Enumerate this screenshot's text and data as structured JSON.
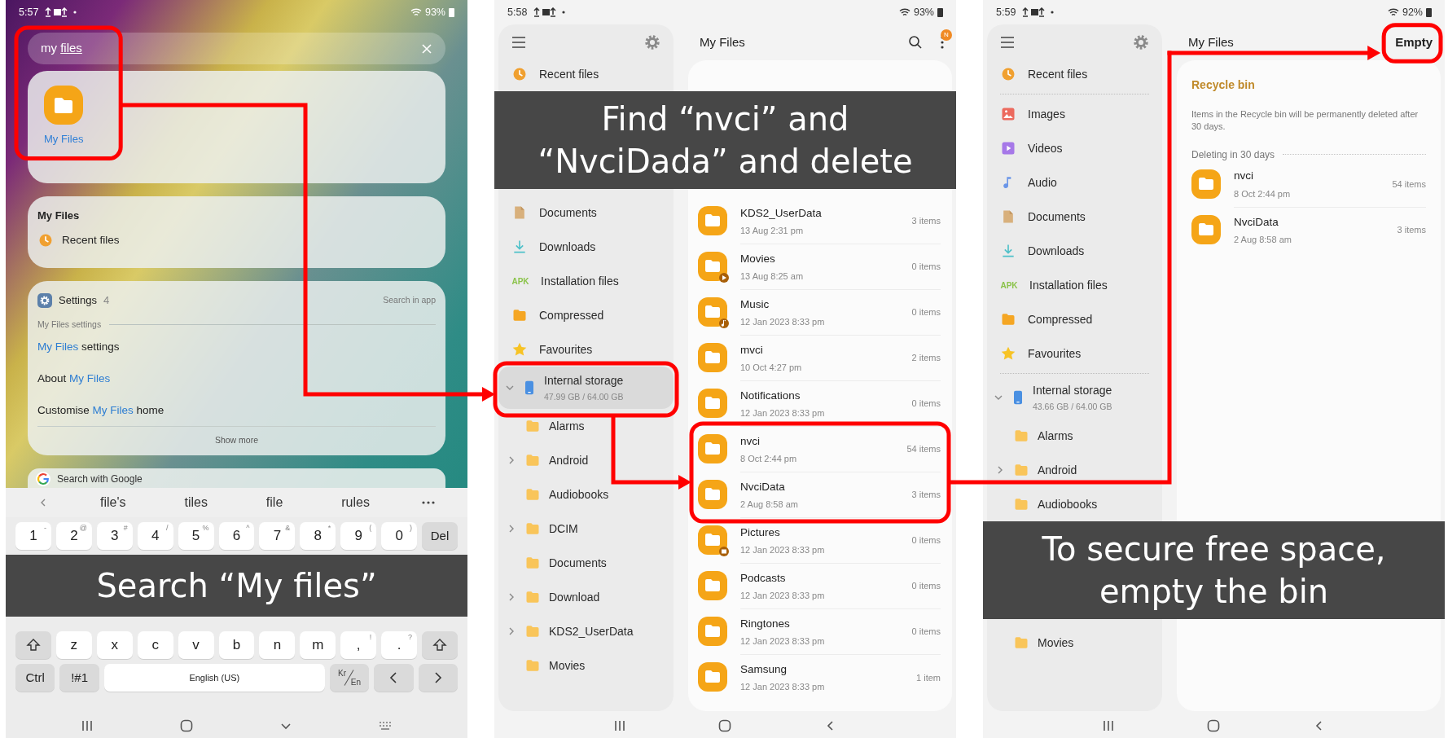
{
  "panels": [
    {
      "kind": "search",
      "status_bar": {
        "time": "5:57",
        "battery": "93%"
      },
      "search": {
        "typed": "my",
        "composing": "files"
      },
      "app_result": {
        "label": "My Files"
      },
      "app_card": {
        "title": "My Files",
        "items": [
          "Recent files"
        ]
      },
      "settings_card": {
        "title": "Settings",
        "count": "4",
        "action": "Search in app",
        "section": "My Files settings",
        "items": [
          "**My Files** settings",
          "About **My Files**",
          "Customise **My Files** home"
        ],
        "more": "Show more"
      },
      "web_search": {
        "label": "Search with Google"
      },
      "keyboard": {
        "suggestions": [
          "file's",
          "tiles",
          "file",
          "rules"
        ],
        "rows_above": [
          [
            {
              "kind": "char",
              "label": "1",
              "alt": "-"
            },
            {
              "kind": "char",
              "label": "2",
              "alt": "@"
            },
            {
              "kind": "char",
              "label": "3",
              "alt": "#"
            },
            {
              "kind": "char",
              "label": "4",
              "alt": "/"
            },
            {
              "kind": "char",
              "label": "5",
              "alt": "%"
            },
            {
              "kind": "char",
              "label": "6",
              "alt": "^"
            },
            {
              "kind": "char",
              "label": "7",
              "alt": "&"
            },
            {
              "kind": "char",
              "label": "8",
              "alt": "*"
            },
            {
              "kind": "char",
              "label": "9",
              "alt": "("
            },
            {
              "kind": "char",
              "label": "0",
              "alt": ")"
            },
            {
              "kind": "text",
              "label": "Del"
            }
          ]
        ],
        "caption": "Search “My files”",
        "rows_below": [
          [
            {
              "kind": "shift"
            },
            {
              "kind": "char",
              "label": "z"
            },
            {
              "kind": "char",
              "label": "x"
            },
            {
              "kind": "char",
              "label": "c"
            },
            {
              "kind": "char",
              "label": "v"
            },
            {
              "kind": "char",
              "label": "b"
            },
            {
              "kind": "char",
              "label": "n"
            },
            {
              "kind": "char",
              "label": "m"
            },
            {
              "kind": "char",
              "label": ",",
              "alt": "!"
            },
            {
              "kind": "char",
              "label": ".",
              "alt": "?"
            },
            {
              "kind": "shift"
            }
          ],
          [
            {
              "kind": "text",
              "label": "Ctrl"
            },
            {
              "kind": "text",
              "label": "!#1"
            },
            {
              "kind": "space",
              "label": "English (US)"
            },
            {
              "kind": "lang",
              "label": "Kr",
              "alt": "En"
            },
            {
              "kind": "left"
            },
            {
              "kind": "right"
            }
          ]
        ]
      },
      "nav_bar": [
        {
          "kind": "recents"
        },
        {
          "kind": "home"
        },
        {
          "kind": "hide"
        },
        {
          "kind": "keyboard"
        }
      ]
    },
    {
      "kind": "files",
      "status_bar": {
        "time": "5:58",
        "battery": "93%"
      },
      "sections": [
        {
          "kind": "split",
          "sidebar": [
            {
              "kind": "toolbar"
            },
            {
              "kind": "recent",
              "label": "Recent files",
              "selected": false
            }
          ],
          "main": [
            {
              "kind": "header",
              "title": "My Files",
              "actions": [
                {
                  "kind": "search"
                },
                {
                  "kind": "more",
                  "badge": "N"
                }
              ]
            },
            {
              "kind": "card"
            }
          ]
        },
        {
          "kind": "caption",
          "text": "Find “nvci” and\n“NvciDada” and delete"
        },
        {
          "kind": "split",
          "sidebar": [
            {
              "kind": "documents",
              "label": "Documents",
              "selected": false
            },
            {
              "kind": "downloads",
              "label": "Downloads",
              "selected": false
            },
            {
              "kind": "apk",
              "label": "Installation files",
              "icon_text": "APK",
              "selected": false
            },
            {
              "kind": "compressed",
              "label": "Compressed",
              "selected": false
            },
            {
              "kind": "favourites",
              "label": "Favourites",
              "selected": false
            },
            {
              "kind": "storage",
              "label": "Internal storage",
              "detail": "47.99 GB / 64.00 GB",
              "selected": true,
              "expanded": true
            },
            {
              "kind": "folder",
              "label": "Alarms",
              "expandable": false,
              "selected": false
            },
            {
              "kind": "folder",
              "label": "Android",
              "expandable": true,
              "selected": false
            },
            {
              "kind": "folder",
              "label": "Audiobooks",
              "expandable": false,
              "selected": false
            },
            {
              "kind": "folder",
              "label": "DCIM",
              "expandable": true,
              "selected": false
            },
            {
              "kind": "folder",
              "label": "Documents",
              "expandable": false,
              "selected": false
            },
            {
              "kind": "folder",
              "label": "Download",
              "expandable": true,
              "selected": false
            },
            {
              "kind": "folder",
              "label": "KDS2_UserData",
              "expandable": true,
              "selected": false
            },
            {
              "kind": "folder",
              "label": "Movies",
              "expandable": false,
              "selected": false
            }
          ],
          "main": [
            {
              "kind": "card",
              "rows": [
                {
                  "kind": "folder",
                  "name": "KDS2_UserData",
                  "date": "13 Aug 2:31 pm",
                  "count": "3 items"
                },
                {
                  "kind": "movies",
                  "name": "Movies",
                  "date": "13 Aug 8:25 am",
                  "count": "0 items"
                },
                {
                  "kind": "music",
                  "name": "Music",
                  "date": "12 Jan 2023 8:33 pm",
                  "count": "0 items"
                },
                {
                  "kind": "folder",
                  "name": "mvci",
                  "date": "10 Oct 4:27 pm",
                  "count": "2 items"
                },
                {
                  "kind": "folder",
                  "name": "Notifications",
                  "date": "12 Jan 2023 8:33 pm",
                  "count": "0 items"
                },
                {
                  "kind": "folder",
                  "name": "nvci",
                  "date": "8 Oct 2:44 pm",
                  "count": "54 items"
                },
                {
                  "kind": "folder",
                  "name": "NvciData",
                  "date": "2 Aug 8:58 am",
                  "count": "3 items"
                },
                {
                  "kind": "pictures",
                  "name": "Pictures",
                  "date": "12 Jan 2023 8:33 pm",
                  "count": "0 items"
                },
                {
                  "kind": "folder",
                  "name": "Podcasts",
                  "date": "12 Jan 2023 8:33 pm",
                  "count": "0 items"
                },
                {
                  "kind": "folder",
                  "name": "Ringtones",
                  "date": "12 Jan 2023 8:33 pm",
                  "count": "0 items"
                },
                {
                  "kind": "folder",
                  "name": "Samsung",
                  "date": "12 Jan 2023 8:33 pm",
                  "count": "1 item"
                }
              ]
            }
          ]
        }
      ],
      "nav_bar": [
        {
          "kind": "recents"
        },
        {
          "kind": "home"
        },
        {
          "kind": "back"
        }
      ]
    },
    {
      "kind": "files",
      "status_bar": {
        "time": "5:59",
        "battery": "92%"
      },
      "sections": [
        {
          "kind": "split",
          "sidebar": [
            {
              "kind": "toolbar"
            },
            {
              "kind": "recent",
              "label": "Recent files",
              "selected": false
            },
            {
              "kind": "divider"
            },
            {
              "kind": "images",
              "label": "Images",
              "selected": false
            },
            {
              "kind": "videos",
              "label": "Videos",
              "selected": false
            },
            {
              "kind": "audio",
              "label": "Audio",
              "selected": false
            },
            {
              "kind": "documents",
              "label": "Documents",
              "selected": false
            },
            {
              "kind": "downloads",
              "label": "Downloads",
              "selected": false
            },
            {
              "kind": "apk",
              "label": "Installation files",
              "icon_text": "APK",
              "selected": false
            },
            {
              "kind": "compressed",
              "label": "Compressed",
              "selected": false
            },
            {
              "kind": "favourites",
              "label": "Favourites",
              "selected": false
            },
            {
              "kind": "divider"
            },
            {
              "kind": "storage",
              "label": "Internal storage",
              "detail": "43.66 GB / 64.00 GB",
              "selected": false,
              "expanded": true
            },
            {
              "kind": "folder",
              "label": "Alarms",
              "expandable": false,
              "selected": false
            },
            {
              "kind": "folder",
              "label": "Android",
              "expandable": true,
              "selected": false
            },
            {
              "kind": "folder",
              "label": "Audiobooks",
              "expandable": false,
              "selected": false
            }
          ],
          "main": [
            {
              "kind": "header",
              "title": "My Files",
              "actions": [
                {
                  "kind": "text",
                  "label": "Empty"
                }
              ]
            },
            {
              "kind": "card",
              "title": "Recycle bin",
              "note": "Items in the Recycle bin will be permanently deleted after 30 days.",
              "group": "Deleting in 30 days",
              "rows": [
                {
                  "kind": "folder",
                  "name": "nvci",
                  "date": "8 Oct 2:44 pm",
                  "count": "54 items"
                },
                {
                  "kind": "folder",
                  "name": "NvciData",
                  "date": "2 Aug 8:58 am",
                  "count": "3 items"
                }
              ]
            }
          ]
        },
        {
          "kind": "caption",
          "text": "To secure free space,\nempty the bin"
        },
        {
          "kind": "split",
          "sidebar": [
            {
              "kind": "folder",
              "label": "Movies",
              "expandable": false,
              "selected": false
            }
          ],
          "main": [
            {
              "kind": "card"
            }
          ]
        }
      ],
      "nav_bar": [
        {
          "kind": "recents"
        },
        {
          "kind": "home"
        },
        {
          "kind": "back"
        }
      ]
    }
  ]
}
